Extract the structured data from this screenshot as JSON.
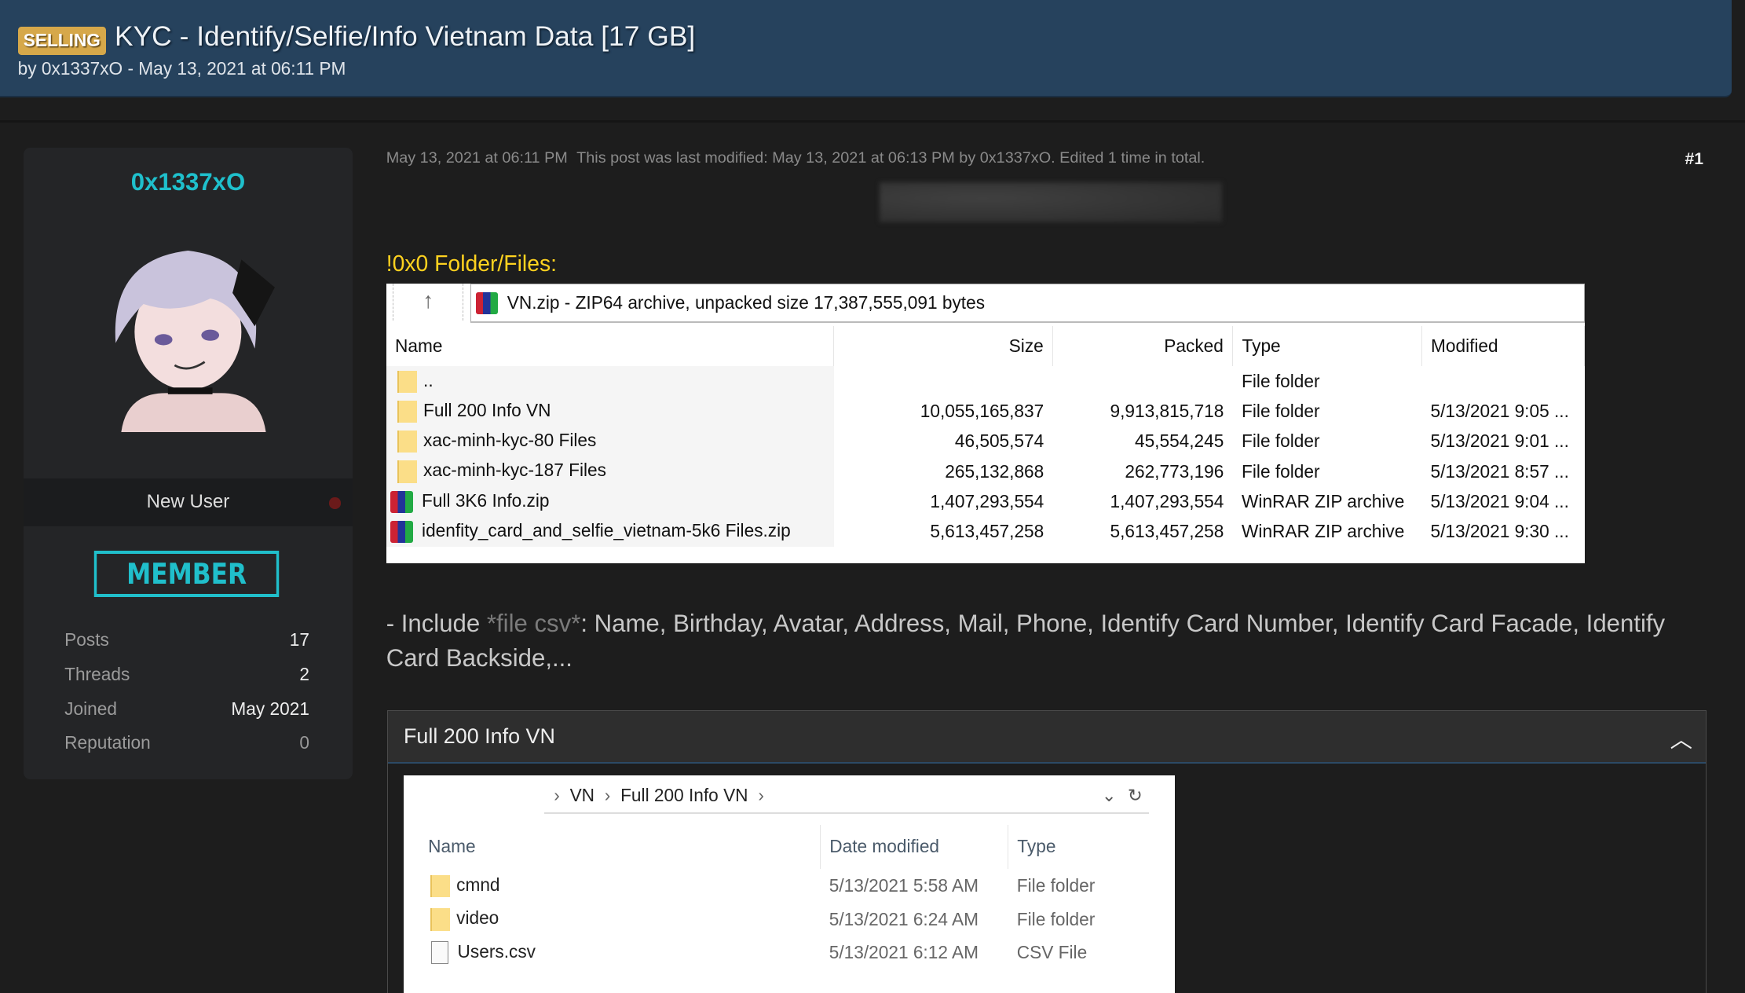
{
  "thread": {
    "badge": "SELLING",
    "title": "KYC - Identify/Selfie/Info Vietnam Data [17 GB]",
    "byline": "by 0x1337xO - May 13, 2021 at 06:11 PM"
  },
  "user": {
    "name": "0x1337xO",
    "rank": "New User",
    "group": "MEMBER",
    "stats": [
      {
        "label": "Posts",
        "value": "17"
      },
      {
        "label": "Threads",
        "value": "2"
      },
      {
        "label": "Joined",
        "value": "May 2021"
      },
      {
        "label": "Reputation",
        "value": "0"
      }
    ]
  },
  "post": {
    "date": "May 13, 2021 at 06:11 PM",
    "modified": "This post was last modified: May 13, 2021 at 06:13 PM by 0x1337xO. Edited 1 time in total.",
    "number": "#1",
    "heading": "!0x0 Folder/Files:",
    "include_prefix": "- Include ",
    "include_highlight": "*file csv*",
    "include_rest": ": Name, Birthday, Avatar, Address, Mail, Phone, Identify Card Number, Identify Card Facade, Identify Card Backside,...",
    "spoiler_title": "Full 200 Info VN"
  },
  "rar": {
    "address": "VN.zip - ZIP64 archive, unpacked size 17,387,555,091 bytes",
    "columns": [
      "Name",
      "Size",
      "Packed",
      "Type",
      "Modified"
    ],
    "rows": [
      {
        "icon": "folder",
        "name": "..",
        "size": "",
        "packed": "",
        "type": "File folder",
        "modified": ""
      },
      {
        "icon": "folder",
        "name": "Full 200 Info VN",
        "size": "10,055,165,837",
        "packed": "9,913,815,718",
        "type": "File folder",
        "modified": "5/13/2021 9:05 ..."
      },
      {
        "icon": "folder",
        "name": "xac-minh-kyc-80 Files",
        "size": "46,505,574",
        "packed": "45,554,245",
        "type": "File folder",
        "modified": "5/13/2021 9:01 ..."
      },
      {
        "icon": "folder",
        "name": "xac-minh-kyc-187 Files",
        "size": "265,132,868",
        "packed": "262,773,196",
        "type": "File folder",
        "modified": "5/13/2021 8:57 ..."
      },
      {
        "icon": "rar",
        "name": "Full 3K6 Info.zip",
        "size": "1,407,293,554",
        "packed": "1,407,293,554",
        "type": "WinRAR ZIP archive",
        "modified": "5/13/2021 9:04 ..."
      },
      {
        "icon": "rar",
        "name": "idenfity_card_and_selfie_vietnam-5k6 Files.zip",
        "size": "5,613,457,258",
        "packed": "5,613,457,258",
        "type": "WinRAR ZIP archive",
        "modified": "5/13/2021 9:30 ..."
      }
    ]
  },
  "explorer": {
    "breadcrumb": [
      "VN",
      "Full 200 Info VN"
    ],
    "columns": [
      "Name",
      "Date modified",
      "Type"
    ],
    "rows": [
      {
        "icon": "folder",
        "name": "cmnd",
        "date": "5/13/2021 5:58 AM",
        "type": "File folder"
      },
      {
        "icon": "folder",
        "name": "video",
        "date": "5/13/2021 6:24 AM",
        "type": "File folder"
      },
      {
        "icon": "file",
        "name": "Users.csv",
        "date": "5/13/2021 6:12 AM",
        "type": "CSV File"
      }
    ]
  },
  "colors": {
    "header": "#26425d",
    "badge": "#d6a84a",
    "username": "#1fc0cc",
    "heading": "#ffd21f"
  }
}
